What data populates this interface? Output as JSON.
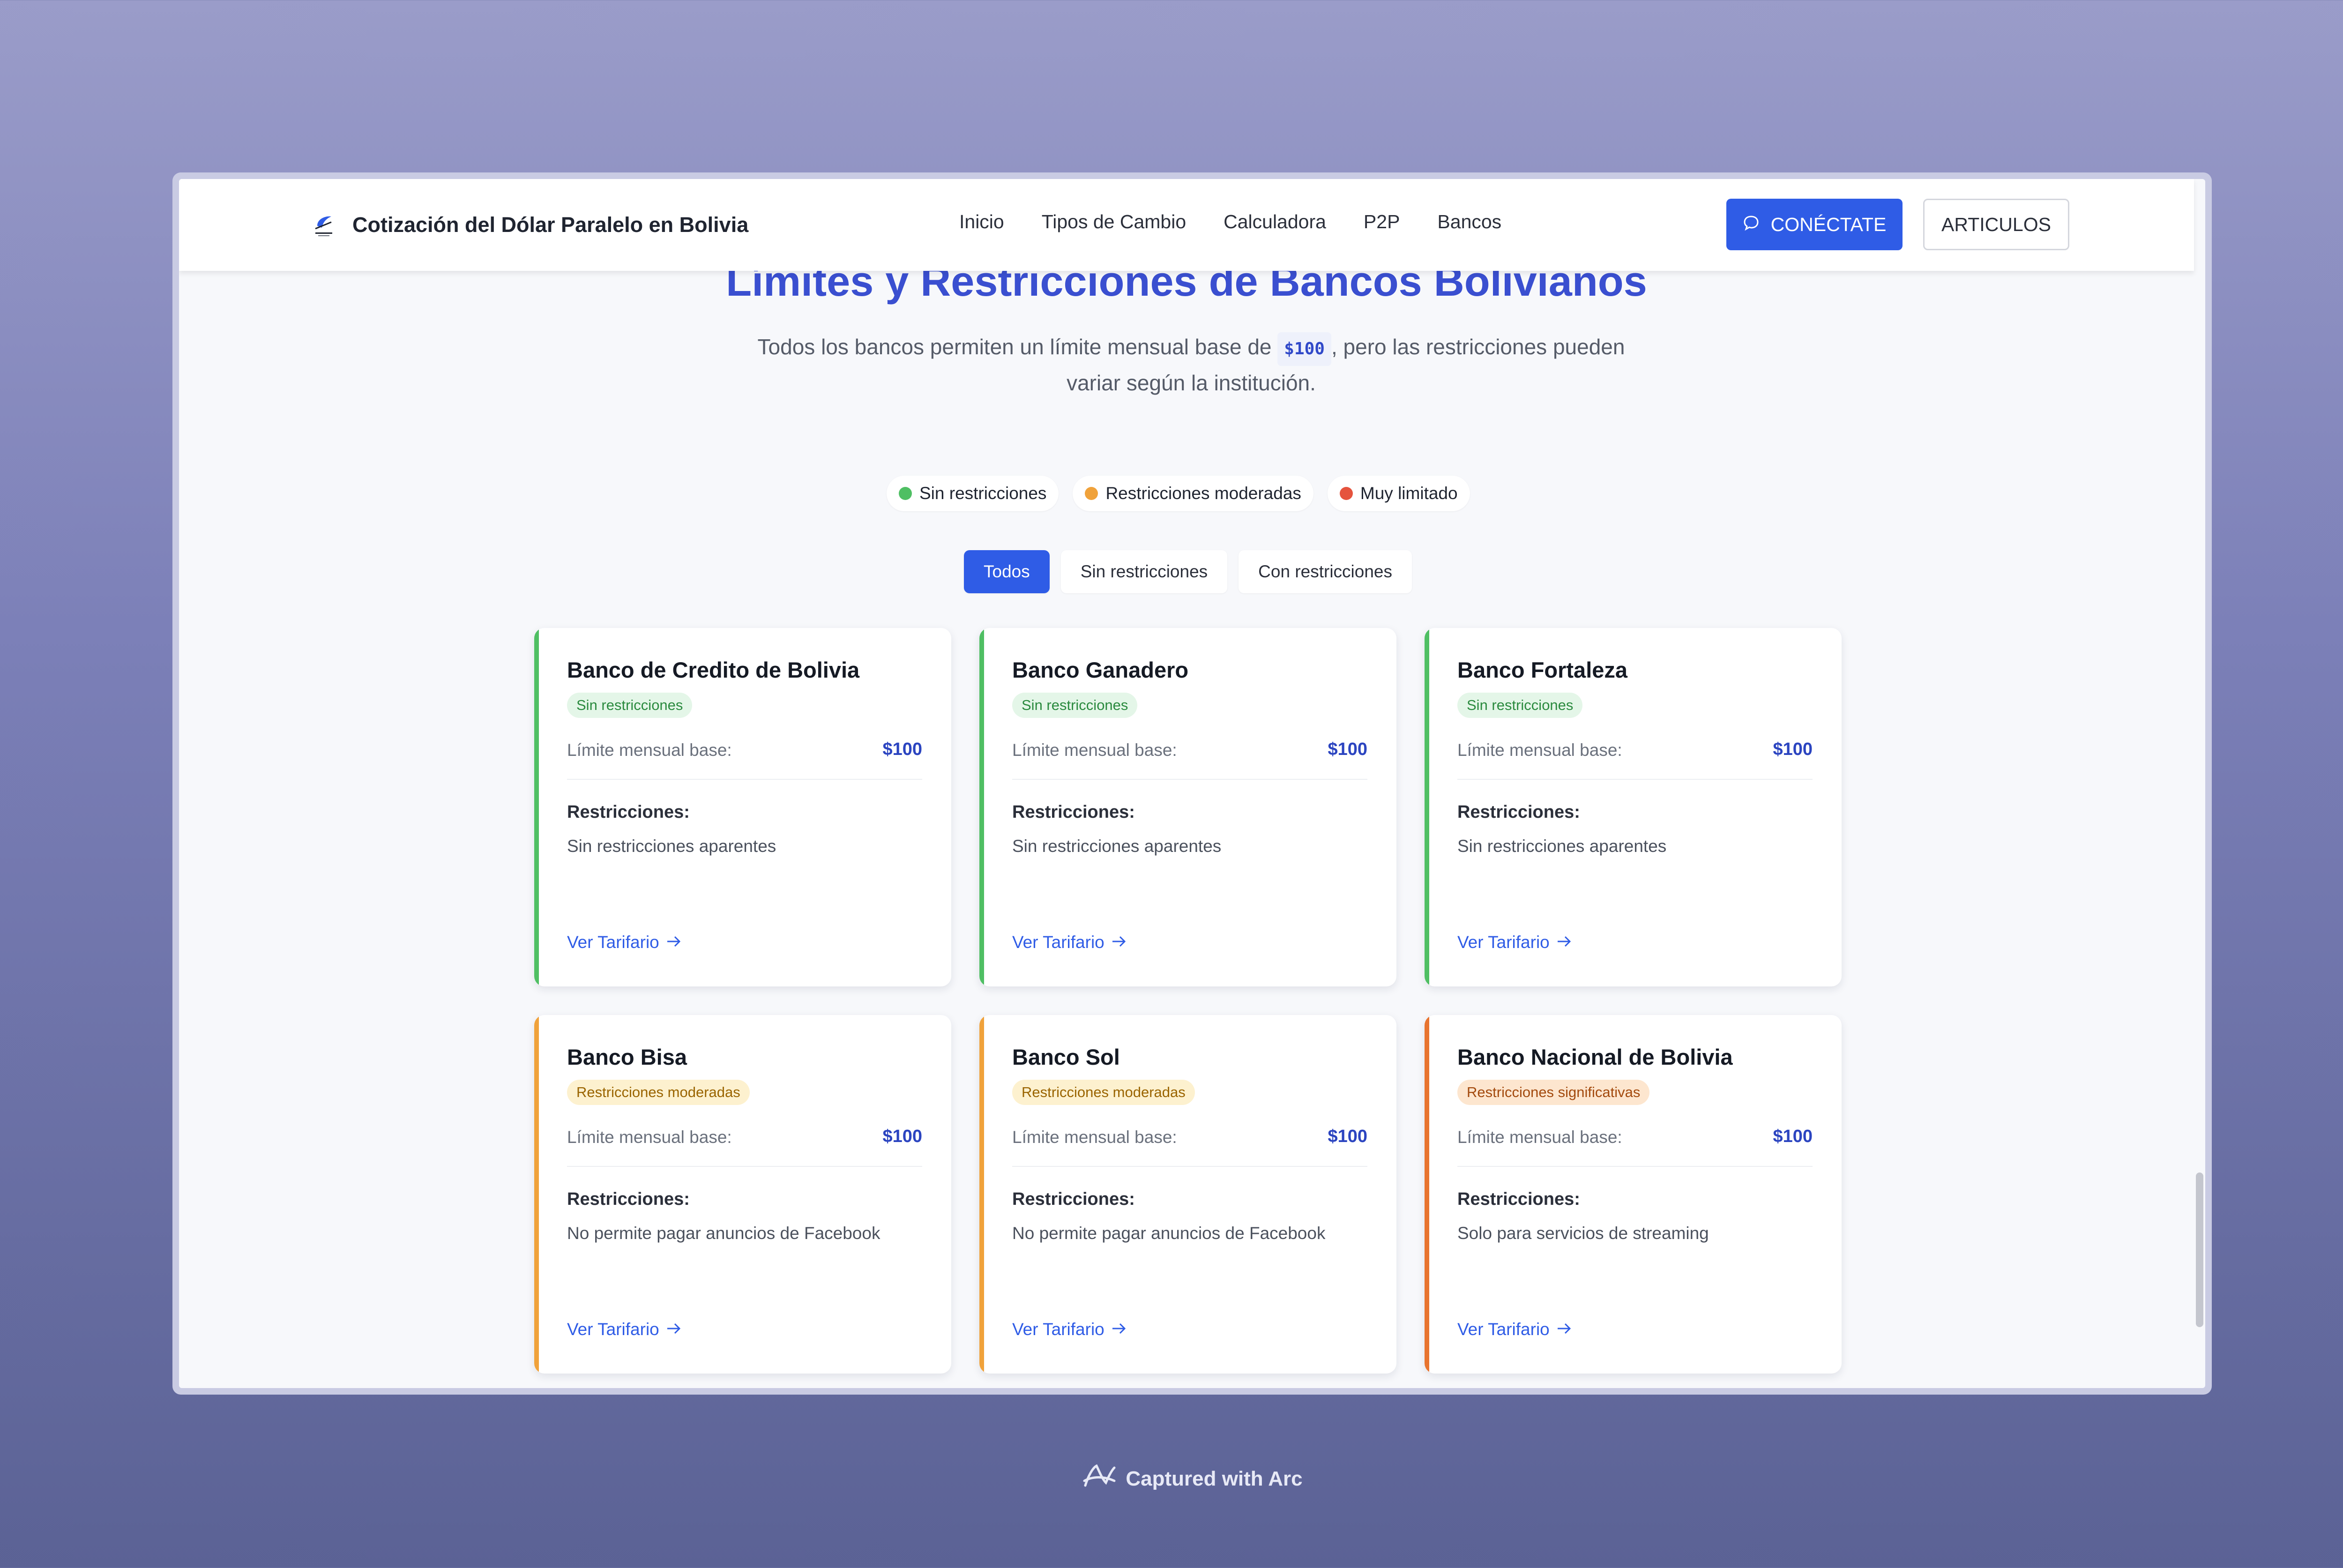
{
  "header": {
    "brand_name": "Cotización del Dólar Paralelo en Bolivia",
    "nav": [
      "Inicio",
      "Tipos de Cambio",
      "Calculadora",
      "P2P",
      "Bancos"
    ],
    "connect_label": "CONÉCTATE",
    "articles_label": "ARTICULOS"
  },
  "hero": {
    "title": "Límites y Restricciones de Bancos Bolivianos",
    "subtitle_before": "Todos los bancos permiten un límite mensual base de ",
    "subtitle_code": "$100",
    "subtitle_after": ", pero las restricciones pueden variar según la institución."
  },
  "legend": [
    {
      "label": "Sin restricciones",
      "color": "#4fbf63"
    },
    {
      "label": "Restricciones moderadas",
      "color": "#f0a23b"
    },
    {
      "label": "Muy limitado",
      "color": "#e5533d"
    }
  ],
  "filters": [
    "Todos",
    "Sin restricciones",
    "Con restricciones"
  ],
  "cards": [
    {
      "name": "Banco de Credito de Bolivia",
      "badge": "Sin restricciones",
      "limit_label": "Límite mensual base:",
      "limit_value": "$100",
      "restr_title": "Restricciones:",
      "restr_text": "Sin restricciones aparentes",
      "link": "Ver Tarifario"
    },
    {
      "name": "Banco Ganadero",
      "badge": "Sin restricciones",
      "limit_label": "Límite mensual base:",
      "limit_value": "$100",
      "restr_title": "Restricciones:",
      "restr_text": "Sin restricciones aparentes",
      "link": "Ver Tarifario"
    },
    {
      "name": "Banco Fortaleza",
      "badge": "Sin restricciones",
      "limit_label": "Límite mensual base:",
      "limit_value": "$100",
      "restr_title": "Restricciones:",
      "restr_text": "Sin restricciones aparentes",
      "link": "Ver Tarifario"
    },
    {
      "name": "Banco Bisa",
      "badge": "Restricciones moderadas",
      "limit_label": "Límite mensual base:",
      "limit_value": "$100",
      "restr_title": "Restricciones:",
      "restr_text": "No permite pagar anuncios de Facebook",
      "link": "Ver Tarifario"
    },
    {
      "name": "Banco Sol",
      "badge": "Restricciones moderadas",
      "limit_label": "Límite mensual base:",
      "limit_value": "$100",
      "restr_title": "Restricciones:",
      "restr_text": "No permite pagar anuncios de Facebook",
      "link": "Ver Tarifario"
    },
    {
      "name": "Banco Nacional de Bolivia",
      "badge": "Restricciones significativas",
      "limit_label": "Límite mensual base:",
      "limit_value": "$100",
      "restr_title": "Restricciones:",
      "restr_text": "Solo para servicios de streaming",
      "link": "Ver Tarifario"
    }
  ],
  "footer": {
    "label": "Captured with Arc"
  }
}
